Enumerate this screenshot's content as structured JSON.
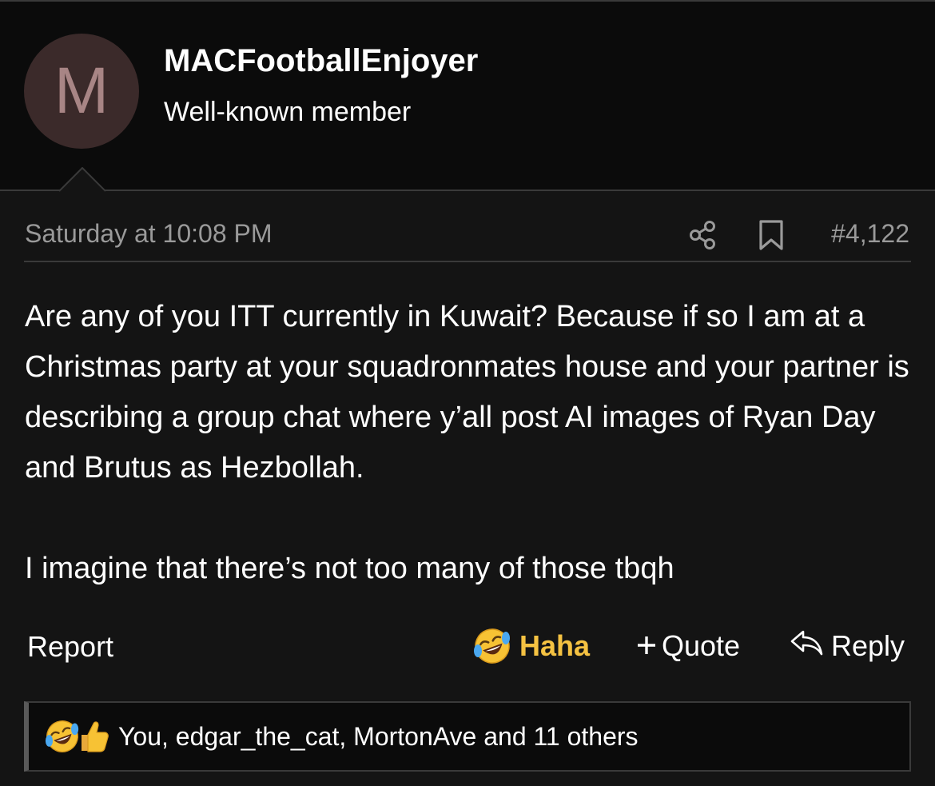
{
  "user": {
    "avatar_letter": "M",
    "username": "MACFootballEnjoyer",
    "title": "Well-known member"
  },
  "post": {
    "date": "Saturday at 10:08 PM",
    "number": "#4,122",
    "paragraphs": [
      "Are any of you ITT currently in Kuwait? Because if so I am at a Christmas party at your squadronmates house and your partner is describing a group chat where y’all post AI images of Ryan Day and Brutus as Hezbollah.",
      "I imagine that there’s not too many of those tbqh"
    ]
  },
  "actions": {
    "report": "Report",
    "haha": "Haha",
    "quote": "Quote",
    "reply": "Reply"
  },
  "reactions": {
    "summary": "You, edgar_the_cat, MortonAve and 11 others",
    "icons": [
      "laughing-crying-emoji",
      "thumbs-up-emoji"
    ]
  },
  "colors": {
    "background": "#141414",
    "header_background": "#0b0b0b",
    "haha_accent": "#f5c242",
    "muted_text": "#9a9a9a",
    "avatar_bg": "#3b2a2a",
    "avatar_fg": "#a88585"
  }
}
